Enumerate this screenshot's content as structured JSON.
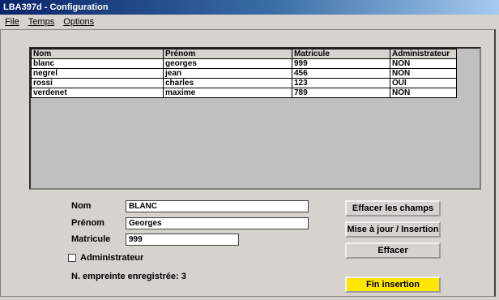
{
  "window": {
    "title": "LBA397d - Configuration"
  },
  "menu": [
    "File",
    "Temps",
    "Options"
  ],
  "table": {
    "headers": [
      "Nom",
      "Prénom",
      "Matricule",
      "Administrateur"
    ],
    "rows": [
      [
        "blanc",
        "georges",
        "999",
        "NON"
      ],
      [
        "negrel",
        "jean",
        "456",
        "NON"
      ],
      [
        "rossi",
        "charles",
        "123",
        "OUI"
      ],
      [
        "verdenet",
        "maxime",
        "789",
        "NON"
      ]
    ]
  },
  "form": {
    "nom_label": "Nom",
    "nom_value": "BLANC",
    "prenom_label": "Prénom",
    "prenom_value": "Georges",
    "matricule_label": "Matricule",
    "matricule_value": "999",
    "admin_label": "Administrateur",
    "admin_checked": false,
    "empreinte_text": "N. empreinte enregistrée: 3"
  },
  "buttons": {
    "effacer_champs": "Effacer les champs",
    "mise_a_jour": "Mise à jour / Insertion",
    "effacer": "Effacer",
    "fin_insertion": "Fin insertion"
  },
  "colors": {
    "title_bar": "#0a246a",
    "fin_button": "#ffe600",
    "background": "#d6d3ce"
  }
}
